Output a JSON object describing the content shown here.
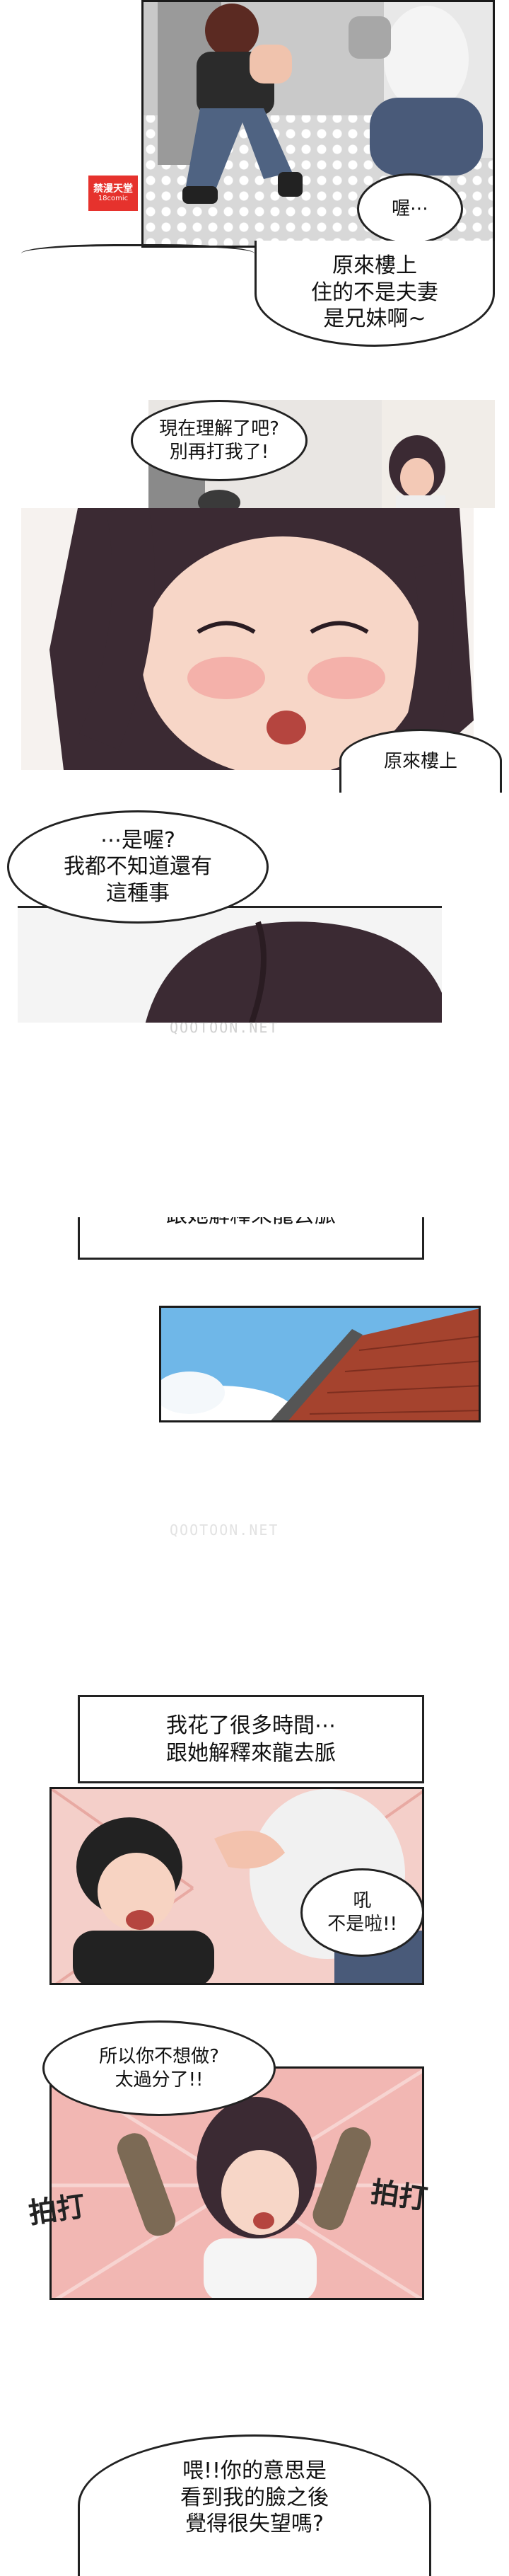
{
  "site_logo": {
    "text": "禁漫天堂",
    "subtext": "18comic"
  },
  "watermarks": [
    "QOOTOON.NET",
    "QOOTOON.NET"
  ],
  "panel1": {
    "bubble_oh": "喔⋯",
    "bubble_siblings": "原來樓上\n住的不是夫妻\n是兄妹啊~"
  },
  "panel2": {
    "bubble_understand": "現在理解了吧?\n別再打我了!",
    "bubble_partial": "原來樓上"
  },
  "panel3": {
    "bubble_didnt_know": "⋯是喔?\n我都不知道還有\n這種事"
  },
  "panel4": {
    "caption_partial": "跟她解釋來龍去脈"
  },
  "panel5": {
    "caption_time": "我花了很多時間⋯\n跟她解釋來龍去脈",
    "bubble_no": "吼\n不是啦!!"
  },
  "panel6": {
    "bubble_dont_want": "所以你不想做?\n太過分了!!",
    "sfx_left": "拍打",
    "sfx_right": "拍打"
  },
  "panel7": {
    "bubble_disappointed": "喂!!你的意思是\n看到我的臉之後\n覺得很失望嗎?"
  },
  "colors": {
    "sky": "#6fb7e8",
    "brick": "#a5432e",
    "hair": "#3b2a33",
    "skin": "#f3c9b6",
    "blush_bg": "#f2b7b3"
  }
}
